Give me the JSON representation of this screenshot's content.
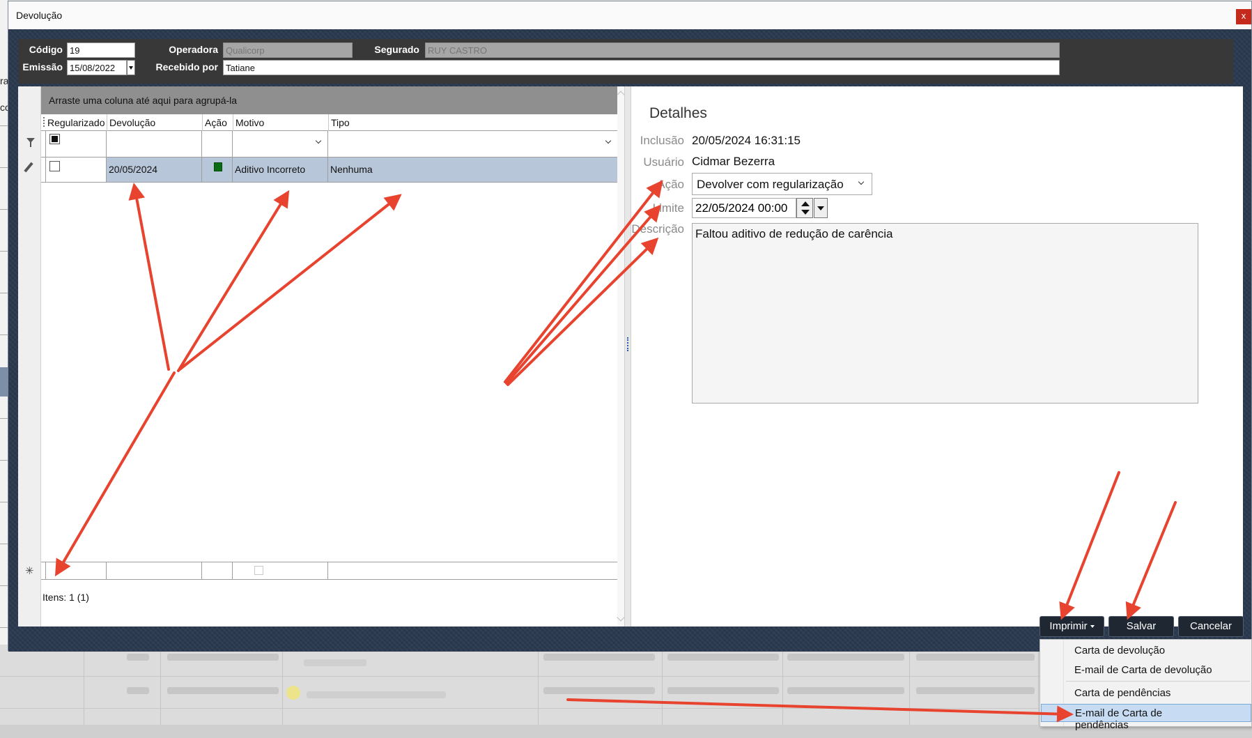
{
  "window": {
    "title": "Devolução",
    "close_label": "x"
  },
  "header": {
    "codigo_label": "Código",
    "codigo_value": "19",
    "emissao_label": "Emissão",
    "emissao_value": "15/08/2022",
    "operadora_label": "Operadora",
    "operadora_value": "Qualicorp",
    "recebido_label": "Recebido por",
    "recebido_value": "Tatiane",
    "segurado_label": "Segurado",
    "segurado_value": "RUY CASTRO"
  },
  "grid": {
    "group_hint": "Arraste uma coluna até aqui para agrupá-la",
    "columns": [
      "Regularizado",
      "Devolução",
      "Ação",
      "Motivo",
      "Tipo"
    ],
    "rows": [
      {
        "regularizado": false,
        "devolucao": "20/05/2024",
        "acao_color": "#0a6b12",
        "motivo": "Aditivo Incorreto",
        "tipo": "Nenhuma"
      }
    ],
    "status": "Itens: 1 (1)"
  },
  "details": {
    "title": "Detalhes",
    "inclusao_label": "Inclusão",
    "inclusao_value": "20/05/2024 16:31:15",
    "usuario_label": "Usuário",
    "usuario_value": "Cidmar Bezerra",
    "acao_label": "Ação",
    "acao_value": "Devolver com regularização",
    "limite_label": "Limite",
    "limite_value": "22/05/2024 00:00",
    "descricao_label": "Descrição",
    "descricao_value": "Faltou aditivo de redução de carência"
  },
  "buttons": {
    "imprimir": "Imprimir",
    "salvar": "Salvar",
    "cancelar": "Cancelar"
  },
  "print_menu": {
    "items": [
      "Carta de devolução",
      "E-mail de Carta de devolução",
      "Carta de pendências",
      "E-mail de Carta de pendências"
    ],
    "highlighted_index": 3
  },
  "background_left_chars": [
    "ra",
    "cc"
  ],
  "colors": {
    "annotation_arrow": "#e8432f",
    "window_bg": "#2b3a50",
    "selected_row": "#b7c6d8",
    "menu_highlight": "#c7dcf2"
  }
}
